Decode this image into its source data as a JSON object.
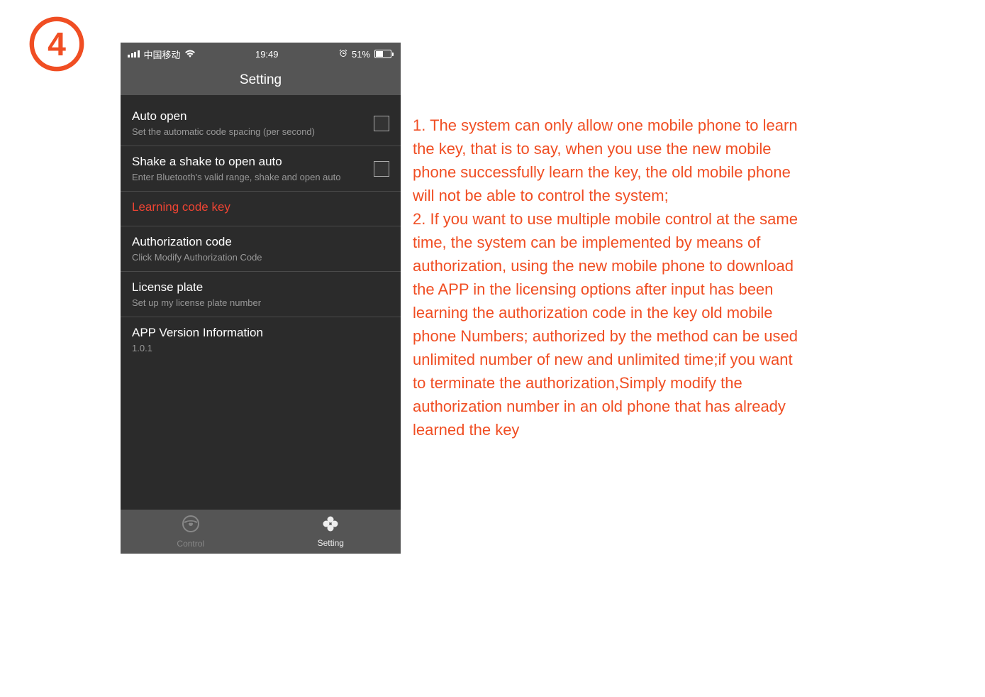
{
  "step": "4",
  "status_bar": {
    "carrier": "中国移动",
    "time": "19:49",
    "battery_percent": "51%"
  },
  "nav_title": "Setting",
  "settings": {
    "auto_open": {
      "title": "Auto open",
      "sub": "Set the automatic code spacing (per second)"
    },
    "shake": {
      "title": "Shake a shake to open auto",
      "sub": "Enter Bluetooth's valid range, shake and open auto"
    },
    "learning": {
      "title": "Learning code key"
    },
    "auth_code": {
      "title": "Authorization code",
      "sub": "Click Modify Authorization Code"
    },
    "license": {
      "title": "License plate",
      "sub": "Set up my license plate number"
    },
    "version": {
      "title": "APP Version Information",
      "sub": "1.0.1"
    }
  },
  "tabs": {
    "control": "Control",
    "setting": "Setting"
  },
  "description": "1. The system can only allow one mobile phone to learn the key, that is to say, when you use the new mobile phone successfully learn the key, the old mobile phone will not be able to control the system;\n2. If you want to use multiple mobile control at the same time, the system can be implemented by means of authorization, using the new mobile phone to download the APP in the licensing options after input has been learning the authorization code in the key old mobile phone Numbers; authorized by the method can be used unlimited number of new and unlimited time;if you want to terminate the authorization,Simply modify the authorization number in an old phone that has already learned the key"
}
